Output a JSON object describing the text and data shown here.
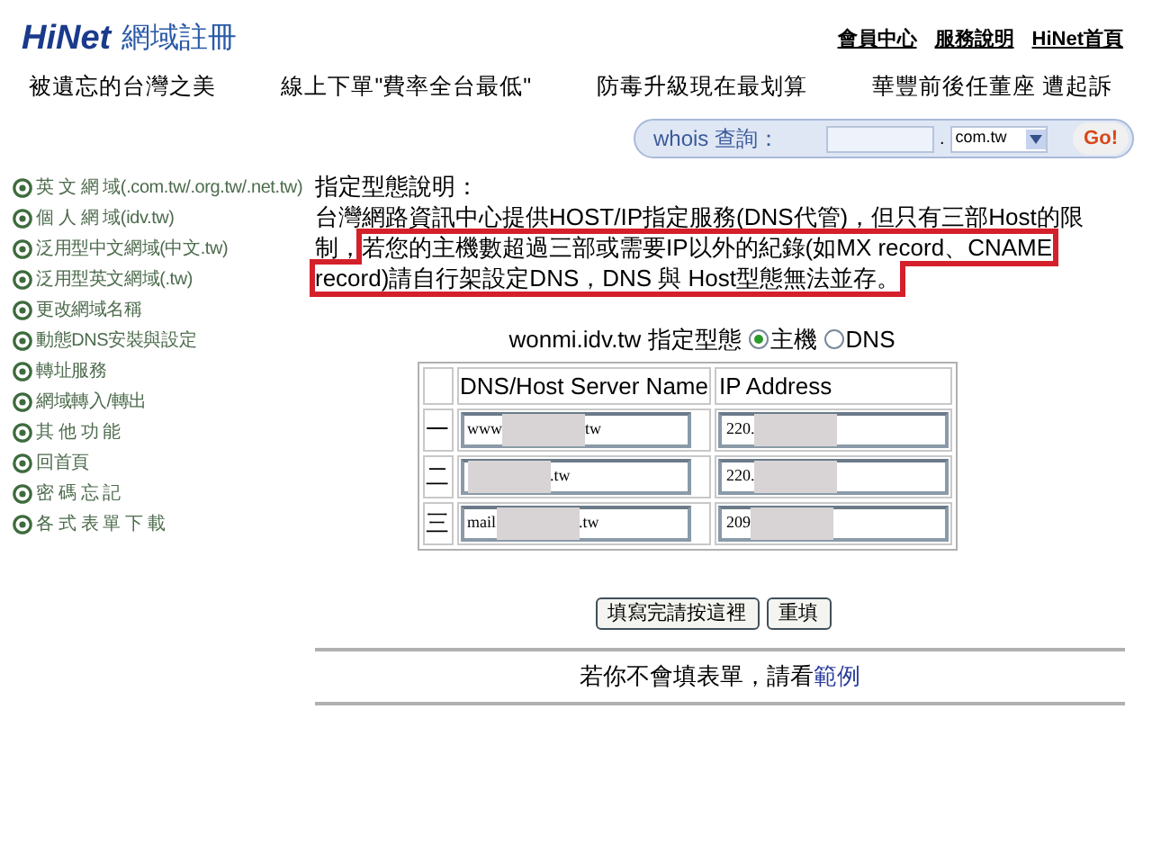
{
  "logo": {
    "brand": "HiNet",
    "title": "網域註冊"
  },
  "top_links": [
    "會員中心",
    "服務說明",
    "HiNet首頁"
  ],
  "news": [
    "被遺忘的台灣之美",
    "線上下單\"費率全台最低\"",
    "防毒升級現在最划算",
    "華豐前後任董座 遭起訴"
  ],
  "whois": {
    "label": "whois 查詢：",
    "dot": ".",
    "tld": "com.tw",
    "button": "Go!"
  },
  "sidebar": {
    "items": [
      "英 文 網 域(.com.tw/.org.tw/.net.tw)",
      "個 人 網 域(idv.tw)",
      "泛用型中文網域(中文.tw)",
      "泛用型英文網域(.tw)",
      "更改網域名稱",
      "動態DNS安裝與設定",
      "轉址服務",
      "網域轉入/轉出",
      "其 他 功 能",
      "回首頁",
      "密 碼 忘 記",
      "各 式 表 單 下 載"
    ]
  },
  "description": {
    "title": "指定型態說明：",
    "segments": [
      {
        "text": "台灣網路資訊中心提供HOST/IP指定服務(DNS代管)，但只有三部Host的限制，",
        "highlighted": false
      },
      {
        "text": "若您的主機數超過三部或需要IP以外的紀錄(如MX record、CNAME record)請自行架設定DNS，DNS 與 Host型態無法並存。",
        "highlighted": true
      }
    ]
  },
  "type_selector": {
    "domain": "wonmi.idv.tw",
    "label": "指定型態",
    "options": [
      {
        "label": "主機",
        "selected": true
      },
      {
        "label": "DNS",
        "selected": false
      }
    ]
  },
  "table": {
    "columns": [
      "DNS/Host Server Name",
      "IP Address"
    ],
    "rows": [
      {
        "index": "一",
        "name": {
          "start": "www",
          "end": "tw"
        },
        "ip": {
          "start": "220."
        }
      },
      {
        "index": "二",
        "name": {
          "end": ".tw"
        },
        "ip": {
          "start": "220."
        }
      },
      {
        "index": "三",
        "name": {
          "start": "mail",
          "end": ".tw"
        },
        "ip": {
          "start": "209"
        }
      }
    ]
  },
  "buttons": [
    "填寫完請按這裡",
    "重填"
  ],
  "footer": {
    "text": "若你不會填表單，請看",
    "link": "範例"
  }
}
